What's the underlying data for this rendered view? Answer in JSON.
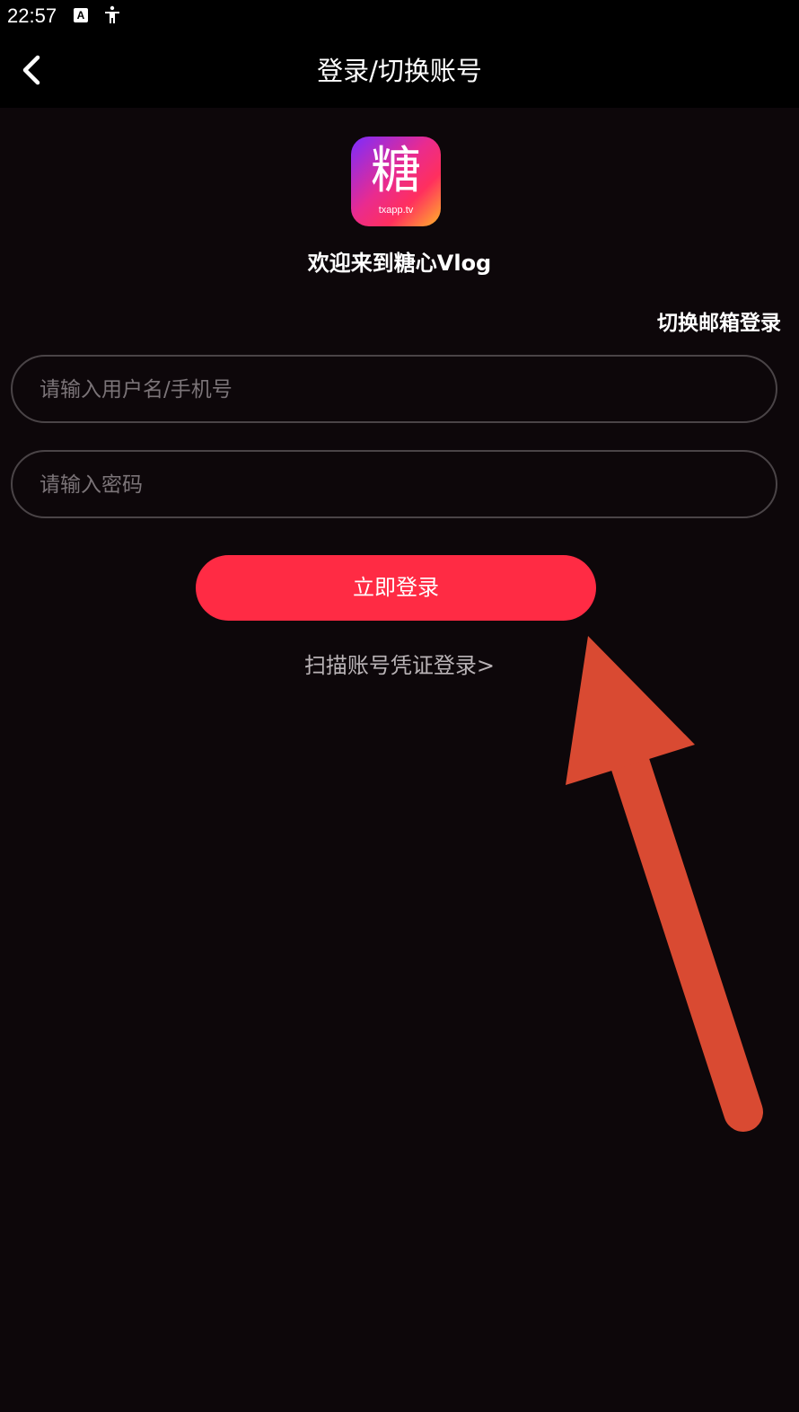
{
  "status_bar": {
    "time": "22:57",
    "icons": [
      "text-a-icon",
      "accessibility-icon"
    ]
  },
  "header": {
    "title": "登录/切换账号",
    "back_icon": "chevron-left-icon"
  },
  "logo": {
    "char": "糖",
    "sub": "txapp.tv"
  },
  "welcome": "欢迎来到糖心Vlog",
  "switch_email_label": "切换邮箱登录",
  "username": {
    "placeholder": "请输入用户名/手机号",
    "value": ""
  },
  "password": {
    "placeholder": "请输入密码",
    "value": ""
  },
  "login_button_label": "立即登录",
  "scan_login_label": "扫描账号凭证登录>",
  "colors": {
    "background": "#0d070a",
    "header_background": "#000000",
    "accent": "#ff2b44",
    "annotation_arrow": "#d94a32"
  }
}
